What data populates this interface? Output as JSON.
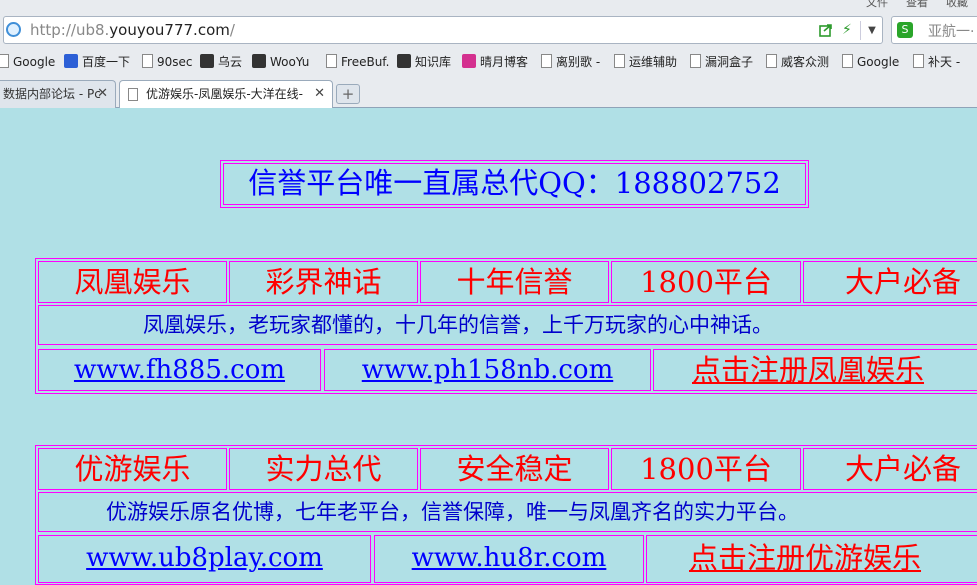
{
  "browser": {
    "menu_items": [
      "文件",
      "查看",
      "收藏"
    ],
    "address": {
      "prefix": "http://ub8.",
      "domain": "youyou777.com",
      "suffix": "/"
    },
    "search_placeholder": "亚航一·",
    "bookmarks": [
      "Google",
      "百度一下",
      "90sec",
      "乌云",
      "WooYu",
      "FreeBuf.",
      "知识库",
      "晴月博客",
      "离别歌 -",
      "运维辅助",
      "漏洞盒子",
      "威客众测",
      "Google",
      "补天 -"
    ],
    "tabs": [
      {
        "title": "数据内部论坛 - Pc",
        "close": "✕"
      },
      {
        "title": "优游娱乐-凤凰娱乐-大洋在线-",
        "close": "✕"
      }
    ],
    "new_tab": "+"
  },
  "page": {
    "qq_banner": "信誉平台唯一直属总代QQ：188802752",
    "sections": [
      {
        "tags": [
          "凤凰娱乐",
          "彩界神话",
          "十年信誉",
          "1800平台",
          "大户必备"
        ],
        "description": "凤凰娱乐，老玩家都懂的，十几年的信誉，上千万玩家的心中神话。",
        "links": [
          "www.fh885.com",
          "www.ph158nb.com"
        ],
        "register": "点击注册凤凰娱乐"
      },
      {
        "tags": [
          "优游娱乐",
          "实力总代",
          "安全稳定",
          "1800平台",
          "大户必备"
        ],
        "description": "优游娱乐原名优博，七年老平台，信誉保障，唯一与凤凰齐名的实力平台。",
        "links": [
          "www.ub8play.com",
          "www.hu8r.com"
        ],
        "register": "点击注册优游娱乐"
      }
    ]
  },
  "colors": {
    "page_background": "#b0e0e6",
    "border": "#ff00ff",
    "tag_text": "#ff0000",
    "desc_text": "#0000cc",
    "link_text": "#0000ff"
  }
}
